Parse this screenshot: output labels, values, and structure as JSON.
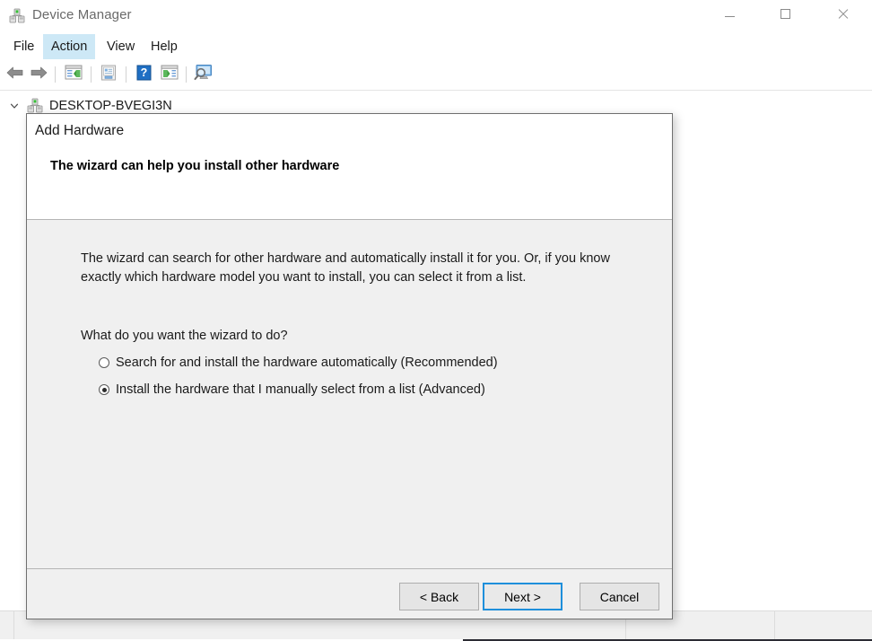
{
  "window": {
    "title": "Device Manager",
    "icon": "device-manager-icon",
    "controls": {
      "minimize": "minimize-icon",
      "maximize": "maximize-icon",
      "close": "close-icon"
    }
  },
  "menubar": {
    "items": [
      {
        "label": "File",
        "selected": false
      },
      {
        "label": "Action",
        "selected": true
      },
      {
        "label": "View",
        "selected": false
      },
      {
        "label": "Help",
        "selected": false
      }
    ],
    "highlight_color": "#cde8f6"
  },
  "toolbar": {
    "items": [
      {
        "name": "back-arrow-icon"
      },
      {
        "name": "forward-arrow-icon"
      },
      {
        "name": "separator"
      },
      {
        "name": "show-hide-console-tree-icon"
      },
      {
        "name": "separator"
      },
      {
        "name": "properties-icon"
      },
      {
        "name": "separator"
      },
      {
        "name": "help-icon"
      },
      {
        "name": "show-hide-action-pane-icon"
      },
      {
        "name": "separator"
      },
      {
        "name": "scan-for-hardware-changes-icon"
      }
    ]
  },
  "tree": {
    "root": {
      "label": "DESKTOP-BVEGI3N",
      "expander": "chevron-down-icon",
      "icon": "computer-icon",
      "expanded": true
    }
  },
  "dialog": {
    "title": "Add Hardware",
    "heading": "The wizard can help you install other hardware",
    "paragraph": "The wizard can search for other hardware and automatically install it for you. Or, if you know exactly which hardware model you want to install, you can select it from a list.",
    "question": "What do you want the wizard to do?",
    "options": [
      {
        "label": "Search for and install the hardware automatically (Recommended)",
        "selected": false
      },
      {
        "label": "Install the hardware that I manually select from a list (Advanced)",
        "selected": true
      }
    ],
    "buttons": {
      "back": "< Back",
      "next": "Next >",
      "cancel": "Cancel"
    },
    "default_button": "Next >",
    "focus_color": "#1e8fdb"
  }
}
